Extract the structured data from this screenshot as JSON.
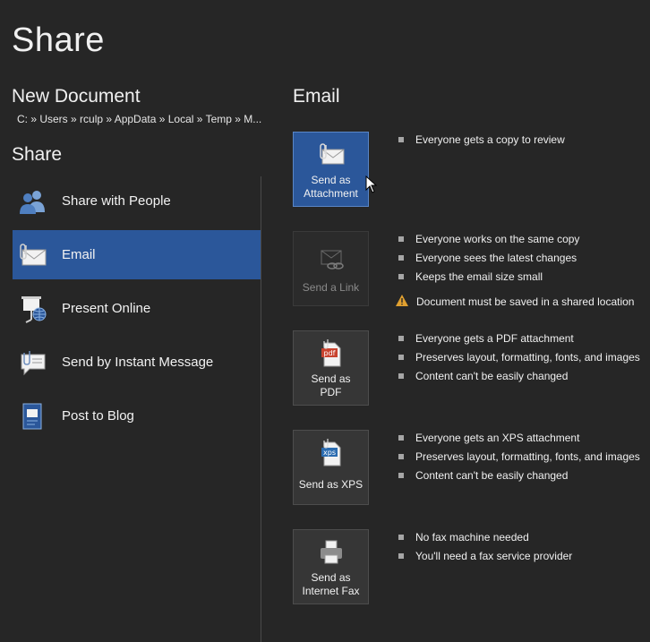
{
  "page": {
    "title": "Share"
  },
  "document": {
    "name": "New Document",
    "path": "C: » Users » rculp » AppData » Local » Temp » M..."
  },
  "share_section": {
    "heading": "Share",
    "items": [
      {
        "label": "Share with People",
        "icon": "share-people-icon"
      },
      {
        "label": "Email",
        "icon": "email-attachment-icon",
        "selected": true
      },
      {
        "label": "Present Online",
        "icon": "present-online-icon"
      },
      {
        "label": "Send by Instant Message",
        "icon": "instant-message-icon"
      },
      {
        "label": "Post to Blog",
        "icon": "blog-icon"
      }
    ]
  },
  "email": {
    "heading": "Email",
    "options": [
      {
        "label_line1": "Send as",
        "label_line2": "Attachment",
        "icon": "attachment-envelope-icon",
        "selected": true,
        "bullets": [
          "Everyone gets a copy to review"
        ]
      },
      {
        "label_line1": "Send a Link",
        "label_line2": "",
        "icon": "link-envelope-icon",
        "disabled": true,
        "bullets": [
          "Everyone works on the same copy",
          "Everyone sees the latest changes",
          "Keeps the email size small"
        ],
        "warning": "Document must be saved in a shared location"
      },
      {
        "label_line1": "Send as",
        "label_line2": "PDF",
        "icon": "pdf-icon",
        "bullets": [
          "Everyone gets a PDF attachment",
          "Preserves layout, formatting, fonts, and images",
          "Content can't be easily changed"
        ]
      },
      {
        "label_line1": "Send as XPS",
        "label_line2": "",
        "icon": "xps-icon",
        "bullets": [
          "Everyone gets an XPS attachment",
          "Preserves layout, formatting, fonts, and images",
          "Content can't be easily changed"
        ]
      },
      {
        "label_line1": "Send as",
        "label_line2": "Internet Fax",
        "icon": "fax-icon",
        "bullets": [
          "No fax machine needed",
          "You'll need a fax service provider"
        ]
      }
    ]
  },
  "colors": {
    "background": "#262626",
    "accent": "#2b579a",
    "warning": "#e0a030"
  }
}
